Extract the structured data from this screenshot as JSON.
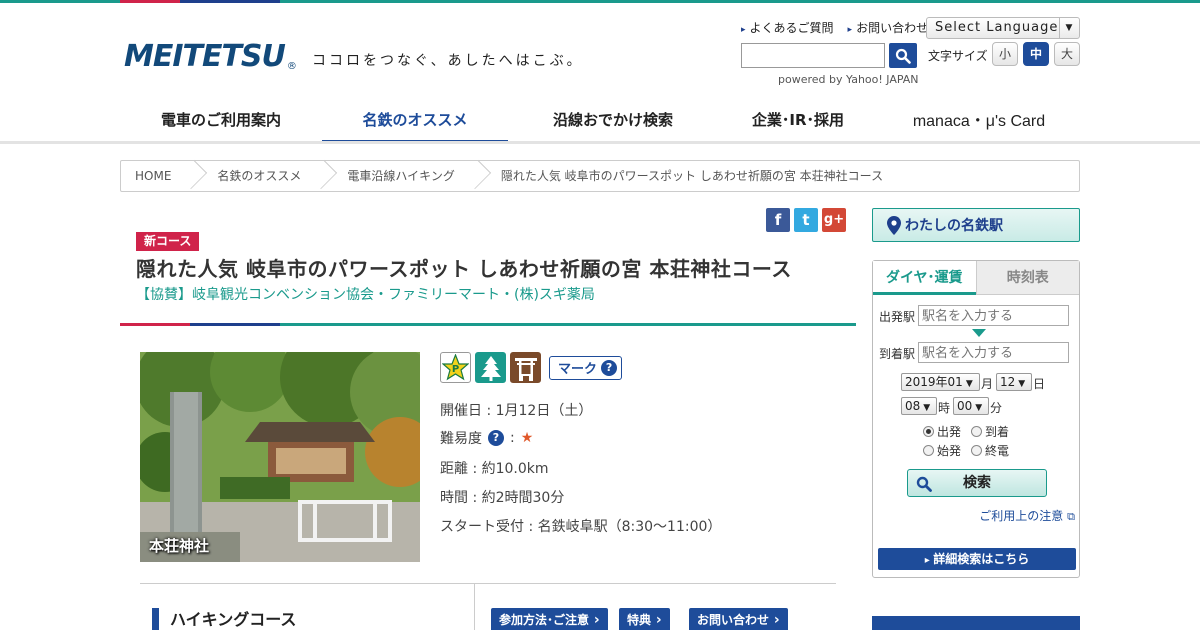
{
  "header": {
    "logo_text": "MEITETSU",
    "logo_reg": "®",
    "tagline": "ココロをつなぐ、あしたへはこぶ。",
    "links": [
      "よくあるご質問",
      "お問い合わせ"
    ],
    "language_select": "Select Language",
    "search_placeholder": "",
    "powered_by": "powered by Yahoo! JAPAN",
    "fontsize_label": "文字サイズ",
    "fontsize_options": [
      "小",
      "中",
      "大"
    ],
    "fontsize_selected": "中"
  },
  "nav": {
    "items": [
      "電車のご利用案内",
      "名鉄のオススメ",
      "沿線おでかけ検索",
      "企業･IR･採用",
      "manaca・μ's Card"
    ],
    "active": "名鉄のオススメ"
  },
  "breadcrumb": [
    "HOME",
    "名鉄のオススメ",
    "電車沿線ハイキング",
    "隠れた人気 岐阜市のパワースポット しあわせ祈願の宮 本荘神社コース"
  ],
  "social": {
    "facebook": "f",
    "twitter": "t",
    "google": "g+"
  },
  "course": {
    "badge": "新コース",
    "title": "隠れた人気 岐阜市のパワースポット しあわせ祈願の宮 本荘神社コース",
    "sponsor": "【協賛】岐阜観光コンベンション協会・ファミリーマート・(株)スギ薬局",
    "photo_caption": "本荘神社",
    "mark_label": "マーク",
    "date": "開催日 : 1月12日（土）",
    "difficulty_label": "難易度",
    "difficulty_sep": ":",
    "difficulty_stars": "★",
    "distance": "距離 : 約10.0km",
    "time": "時間 : 約2時間30分",
    "start": "スタート受付 : 名鉄岐阜駅（8:30～11:00）",
    "section_heading": "ハイキングコース",
    "buttons": [
      "参加方法･ご注意",
      "特典",
      "お問い合わせ"
    ]
  },
  "sidebar": {
    "my_station": "わたしの名鉄駅",
    "tabs": [
      "ダイヤ･運賃",
      "時刻表"
    ],
    "from_label": "出発駅",
    "to_label": "到着駅",
    "from_placeholder": "駅名を入力する",
    "to_placeholder": "駅名を入力する",
    "year_month": "2019年01",
    "month_unit": "月",
    "day": "12",
    "day_unit": "日",
    "hour": "08",
    "hour_unit": "時",
    "minute": "00",
    "minute_unit": "分",
    "radios": [
      "出発",
      "到着",
      "始発",
      "終電"
    ],
    "radio_selected": "出発",
    "search_button": "検索",
    "notice_link": "ご利用上の注意",
    "detail_button": "詳細検索はこちら"
  },
  "colors": {
    "brand_blue": "#1e4c9a",
    "brand_teal": "#1a9a8c",
    "brand_red": "#d0234a"
  }
}
